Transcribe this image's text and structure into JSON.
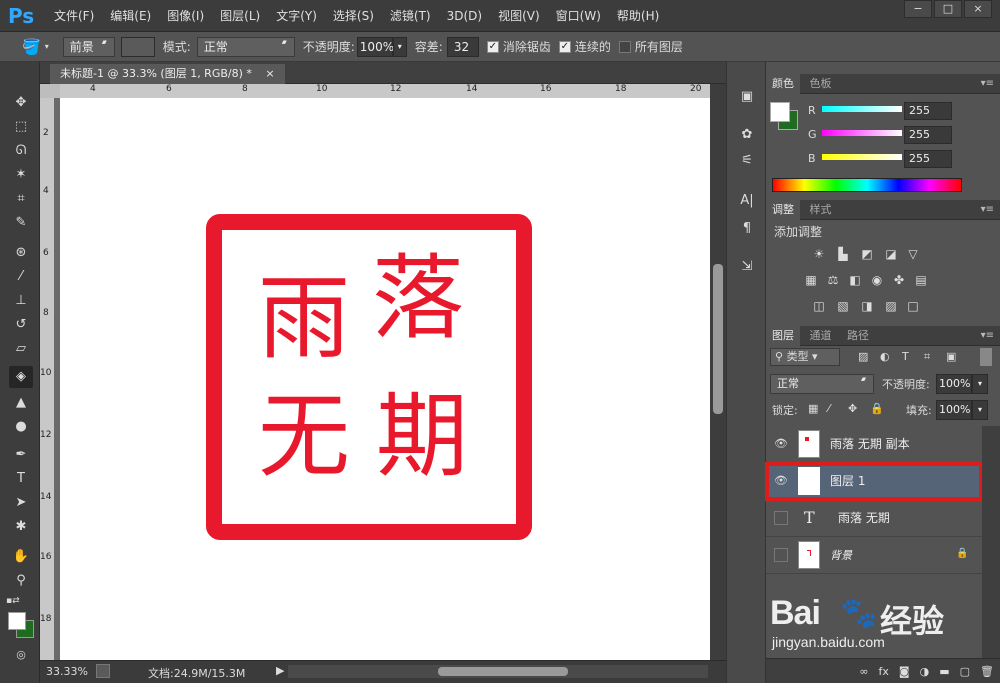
{
  "app": {
    "logo": "Ps",
    "title": "未标题-1 @ 33.3% (图层 1, RGB/8) *"
  },
  "menu": [
    "文件(F)",
    "编辑(E)",
    "图像(I)",
    "图层(L)",
    "文字(Y)",
    "选择(S)",
    "滤镜(T)",
    "3D(D)",
    "视图(V)",
    "窗口(W)",
    "帮助(H)"
  ],
  "window_controls": [
    "−",
    "□",
    "×"
  ],
  "options": {
    "fill_source": "前景",
    "mode_label": "模式:",
    "mode_value": "正常",
    "opacity_label": "不透明度:",
    "opacity_value": "100%",
    "tolerance_label": "容差:",
    "tolerance_value": "32",
    "antialias_label": "消除锯齿",
    "contiguous_label": "连续的",
    "all_layers_label": "所有图层"
  },
  "document": {
    "tab_label": "未标题-1 @ 33.3% (图层 1, RGB/8) *",
    "tab_close": "×",
    "ruler_h": [
      "4",
      "6",
      "8",
      "10",
      "12",
      "14",
      "16",
      "18",
      "20"
    ],
    "ruler_v": [
      "2",
      "4",
      "6",
      "8",
      "10",
      "12",
      "14",
      "16",
      "18"
    ],
    "stamp_chars": [
      "落",
      "雨",
      "期",
      "无"
    ],
    "stamp_color": "#e8192c"
  },
  "status": {
    "zoom": "33.33%",
    "doc_info": "文档:24.9M/15.3M"
  },
  "color_panel": {
    "tabs": [
      "颜色",
      "色板"
    ],
    "channels": [
      {
        "label": "R",
        "value": "255",
        "color": "#00ffff"
      },
      {
        "label": "G",
        "value": "255",
        "color": "#ff00ff"
      },
      {
        "label": "B",
        "value": "255",
        "color": "#ffff00"
      }
    ]
  },
  "adjust_panel": {
    "tabs": [
      "调整",
      "样式"
    ],
    "heading": "添加调整"
  },
  "layers_panel": {
    "tabs": [
      "图层",
      "通道",
      "路径"
    ],
    "filter_kind": "类型",
    "blend_mode": "正常",
    "opacity_label": "不透明度:",
    "opacity_value": "100%",
    "lock_label": "锁定:",
    "fill_label": "填充:",
    "fill_value": "100%",
    "layers": [
      {
        "name": "雨落 无期 副本",
        "visible": true
      },
      {
        "name": "图层 1",
        "visible": true,
        "selected": true
      },
      {
        "name": "雨落 无期",
        "visible": false,
        "type": "text"
      },
      {
        "name": "背景",
        "visible": false,
        "locked": true
      }
    ],
    "bottom_icons": [
      "link-icon",
      "fx-icon",
      "mask-icon",
      "adjustment-icon",
      "folder-icon",
      "new-layer-icon",
      "trash-icon"
    ]
  },
  "watermark": {
    "brand": "Bai",
    "brand2": "经验",
    "url": "jingyan.baidu.com"
  },
  "colors": {
    "accent": "#31a8ff",
    "selection_box": "#e01b1b",
    "layer_selected": "#556477"
  }
}
